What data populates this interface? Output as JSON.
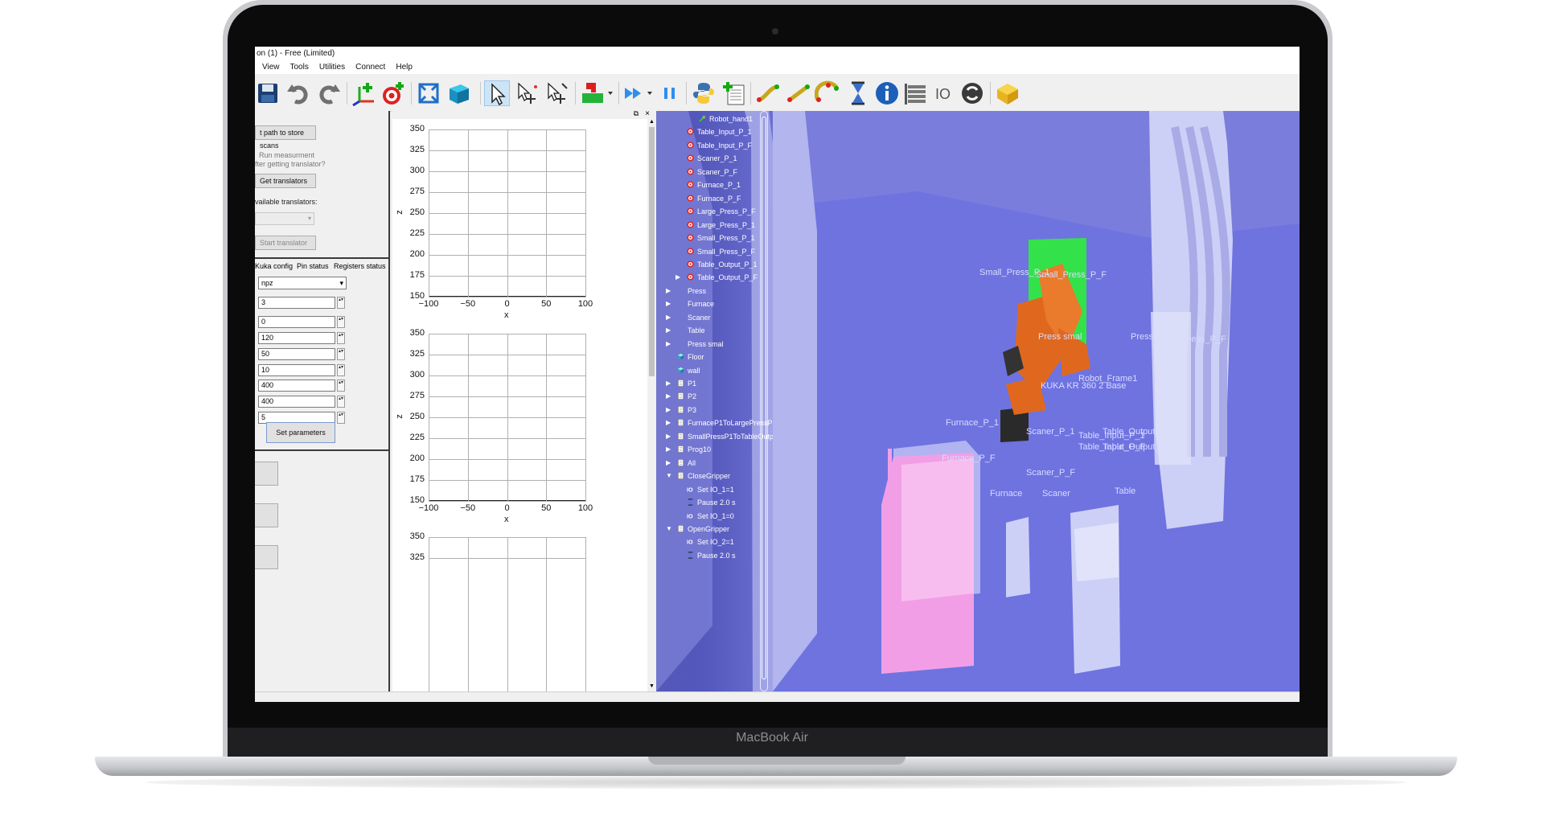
{
  "app": {
    "title": "on (1) - Free (Limited)"
  },
  "menu": [
    "View",
    "Tools",
    "Utilities",
    "Connect",
    "Help"
  ],
  "toolbar": {
    "icons": [
      "save-icon",
      "undo-icon",
      "redo-icon",
      "add-frame-icon",
      "add-target-icon",
      "fit-all-icon",
      "view-3d-icon",
      "select-icon",
      "move-frame-icon",
      "move-reference-icon",
      "collision-icon",
      "run-icon",
      "pause-icon",
      "python-icon",
      "add-program-icon",
      "move-joint-icon",
      "move-linear-icon",
      "move-circular-icon",
      "pause-timer-icon",
      "info-icon",
      "program-call-icon",
      "io-icon",
      "loop-icon",
      "package-icon"
    ]
  },
  "left_panel": {
    "path_button": "t path to store scans",
    "run_measurement": "Run measurment",
    "after_getting": "fter getting translator?",
    "get_translators": "Get translators",
    "available_translators": "vailable translators:",
    "start_translator": "Start translator",
    "tabs": [
      "Kuka config",
      "Pin status",
      "Registers status"
    ],
    "format_select": "npz",
    "params": [
      "3",
      "0",
      "120",
      "50",
      "10",
      "400",
      "400",
      "5"
    ],
    "set_parameters": "Set parameters"
  },
  "plots": {
    "y_ticks": [
      "350",
      "325",
      "300",
      "275",
      "250",
      "225",
      "200",
      "175",
      "150"
    ],
    "x_ticks": [
      "−100",
      "−50",
      "0",
      "50",
      "100"
    ],
    "y_ticks_partial": [
      "350",
      "325"
    ],
    "xlabel": "x",
    "ylabel": "z"
  },
  "tree": [
    {
      "label": "Robot_hand1",
      "indent": 2,
      "icon": "tool-icon"
    },
    {
      "label": "Table_Input_P_1",
      "indent": 1,
      "icon": "target-icon"
    },
    {
      "label": "Table_Input_P_F",
      "indent": 1,
      "icon": "target-icon"
    },
    {
      "label": "Scaner_P_1",
      "indent": 1,
      "icon": "target-icon"
    },
    {
      "label": "Scaner_P_F",
      "indent": 1,
      "icon": "target-icon"
    },
    {
      "label": "Furnace_P_1",
      "indent": 1,
      "icon": "target-icon"
    },
    {
      "label": "Furnace_P_F",
      "indent": 1,
      "icon": "target-icon"
    },
    {
      "label": "Large_Press_P_F",
      "indent": 1,
      "icon": "target-icon"
    },
    {
      "label": "Large_Press_P_1",
      "indent": 1,
      "icon": "target-icon"
    },
    {
      "label": "Small_Press_P_1",
      "indent": 1,
      "icon": "target-icon"
    },
    {
      "label": "Small_Press_P_F",
      "indent": 1,
      "icon": "target-icon"
    },
    {
      "label": "Table_Output_P_1",
      "indent": 1,
      "icon": "target-icon"
    },
    {
      "label": "Table_Output_P_F",
      "indent": 1,
      "icon": "target-icon"
    },
    {
      "label": "Press",
      "indent": 0,
      "icon": "station-icon"
    },
    {
      "label": "Furnace",
      "indent": 0,
      "icon": "station-icon"
    },
    {
      "label": "Scaner",
      "indent": 0,
      "icon": "station-icon"
    },
    {
      "label": "Table",
      "indent": 0,
      "icon": "station-icon"
    },
    {
      "label": "Press smal",
      "indent": 0,
      "icon": "station-icon"
    },
    {
      "label": "Floor",
      "indent": 0,
      "icon": "object-icon"
    },
    {
      "label": "wall",
      "indent": 0,
      "icon": "object-icon"
    },
    {
      "label": "P1",
      "indent": 0,
      "icon": "program-icon"
    },
    {
      "label": "P2",
      "indent": 0,
      "icon": "program-icon"
    },
    {
      "label": "P3",
      "indent": 0,
      "icon": "program-icon"
    },
    {
      "label": "FurnaceP1ToLargePressP1",
      "indent": 0,
      "icon": "program-icon"
    },
    {
      "label": "SmallPressP1ToTableOutputP1",
      "indent": 0,
      "icon": "program-icon"
    },
    {
      "label": "Prog10",
      "indent": 0,
      "icon": "program-icon"
    },
    {
      "label": "All",
      "indent": 0,
      "icon": "program-icon"
    },
    {
      "label": "CloseGripper",
      "indent": 0,
      "icon": "program-icon"
    },
    {
      "label": "Set IO_1=1",
      "indent": 1,
      "icon": "io-icon"
    },
    {
      "label": "Pause 2.0 s",
      "indent": 1,
      "icon": "pause-timer-icon"
    },
    {
      "label": "Set IO_1=0",
      "indent": 1,
      "icon": "io-icon"
    },
    {
      "label": "OpenGripper",
      "indent": 0,
      "icon": "program-icon"
    },
    {
      "label": "Set IO_2=1",
      "indent": 1,
      "icon": "io-icon"
    },
    {
      "label": "Pause 2.0 s",
      "indent": 1,
      "icon": "pause-timer-icon"
    }
  ],
  "viewport": {
    "labels": {
      "small_press_p1": "Small_Press_P_1",
      "small_press_pf": "Small_Press_P_F",
      "press_smal": "Press smal",
      "press": "Press",
      "large_press_pf": "Large_Press_P_F",
      "robot_frame": "Robot_Frame1",
      "robot_base": "KUKA KR 360 2 Base",
      "furnace_p1": "Furnace_P_1",
      "furnace_pf": "Furnace_P_F",
      "scaner_p1": "Scaner_P_1",
      "scaner_pf": "Scaner_P_F",
      "table_input": "Table_Input_P_1",
      "table_output_p1": "Table_Output_P_1",
      "table_input_pf": "Table_Input_P_F",
      "table_output_pf": "Table_Output_P_F",
      "furnace": "Furnace",
      "scaner": "Scaner",
      "table": "Table"
    },
    "colors": {
      "floor": "#6e73e0",
      "robot": "#e0681e",
      "small_press": "#33e24a",
      "furnace": "#f29ee6",
      "machines": "#cdd0f6"
    }
  },
  "laptop": {
    "brand": "MacBook Air"
  }
}
